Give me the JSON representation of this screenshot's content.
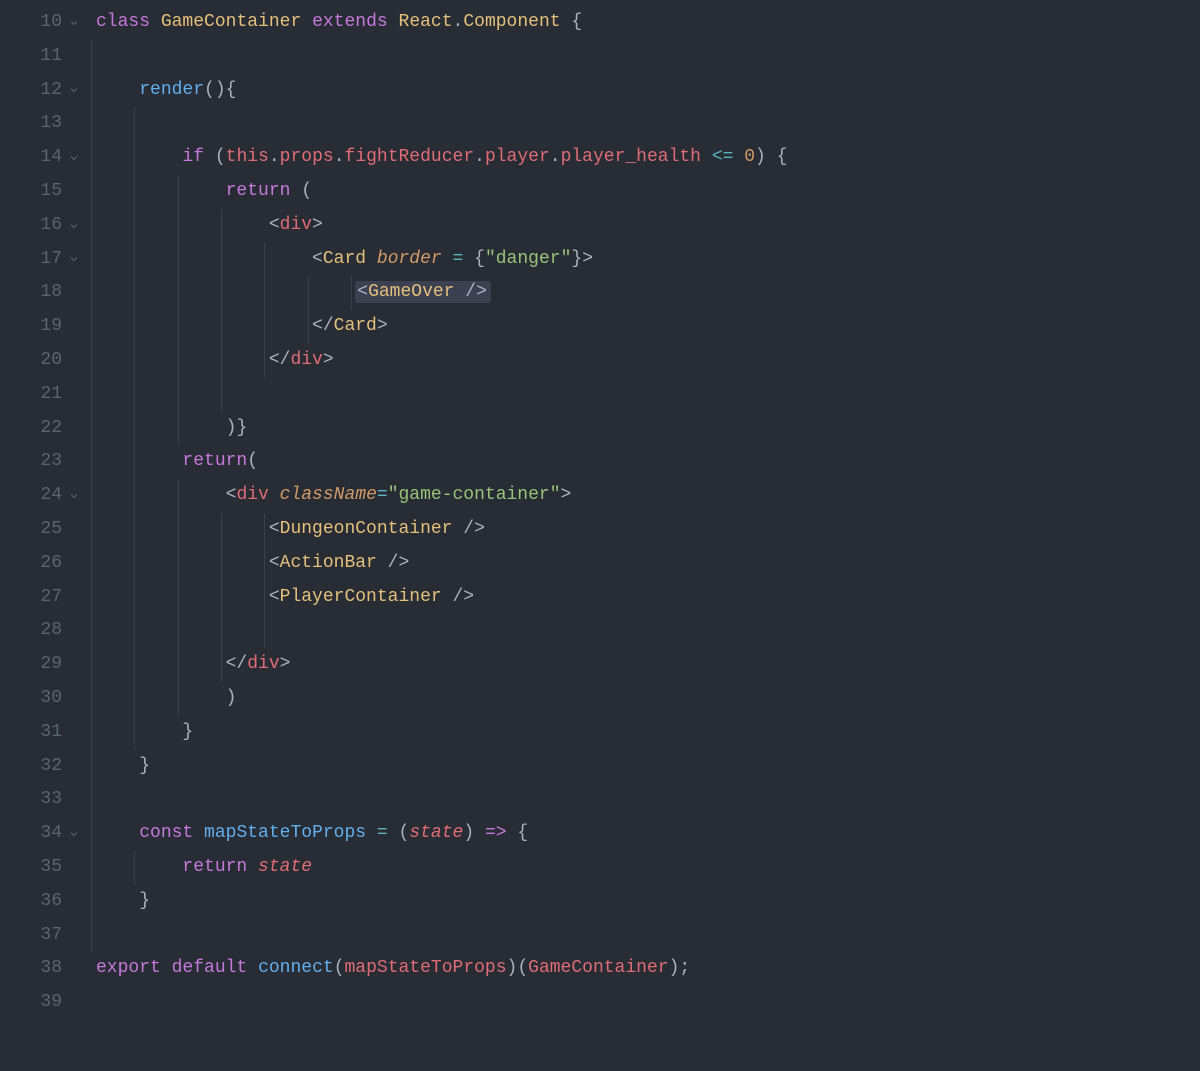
{
  "start_line_number": 10,
  "fold_lines": [
    10,
    12,
    14,
    16,
    17,
    24,
    34
  ],
  "syntax_colors": {
    "keyword": "#c678dd",
    "class": "#e5c07b",
    "function": "#61afef",
    "property": "#e06c75",
    "attribute": "#d19a66",
    "operator": "#56b6c2",
    "string": "#98c379",
    "number": "#d19a66",
    "default": "#abb2bf",
    "background": "#282c34",
    "highlight_bg": "#3b4151"
  },
  "highlighted_line": 18,
  "highlighted_range": "<GameOver />",
  "code_lines": [
    {
      "n": 10,
      "text": "class GameContainer extends React.Component {",
      "tokens": [
        [
          "kw",
          "class"
        ],
        [
          "punc",
          " "
        ],
        [
          "cls",
          "GameContainer"
        ],
        [
          "punc",
          " "
        ],
        [
          "kw",
          "extends"
        ],
        [
          "punc",
          " "
        ],
        [
          "cls",
          "React"
        ],
        [
          "punc",
          "."
        ],
        [
          "cls",
          "Component"
        ],
        [
          "punc",
          " "
        ],
        [
          "punc",
          "{"
        ]
      ]
    },
    {
      "n": 11,
      "text": "",
      "tokens": []
    },
    {
      "n": 12,
      "text": "    render(){",
      "tokens": [
        [
          "punc",
          "    "
        ],
        [
          "fn",
          "render"
        ],
        [
          "punc",
          "()"
        ],
        [
          "punc",
          "{"
        ]
      ]
    },
    {
      "n": 13,
      "text": "",
      "tokens": []
    },
    {
      "n": 14,
      "text": "        if (this.props.fightReducer.player.player_health <= 0) {",
      "tokens": [
        [
          "punc",
          "        "
        ],
        [
          "kw",
          "if"
        ],
        [
          "punc",
          " ("
        ],
        [
          "prop",
          "this"
        ],
        [
          "punc",
          "."
        ],
        [
          "prop",
          "props"
        ],
        [
          "punc",
          "."
        ],
        [
          "prop",
          "fightReducer"
        ],
        [
          "punc",
          "."
        ],
        [
          "prop",
          "player"
        ],
        [
          "punc",
          "."
        ],
        [
          "prop",
          "player_health"
        ],
        [
          "punc",
          " "
        ],
        [
          "op",
          "<="
        ],
        [
          "punc",
          " "
        ],
        [
          "num",
          "0"
        ],
        [
          "punc",
          ") "
        ],
        [
          "punc",
          "{"
        ]
      ]
    },
    {
      "n": 15,
      "text": "            return (",
      "tokens": [
        [
          "punc",
          "            "
        ],
        [
          "kw",
          "return"
        ],
        [
          "punc",
          " ("
        ]
      ]
    },
    {
      "n": 16,
      "text": "                <div>",
      "tokens": [
        [
          "punc",
          "                "
        ],
        [
          "ang",
          "<"
        ],
        [
          "prop",
          "div"
        ],
        [
          "ang",
          ">"
        ]
      ]
    },
    {
      "n": 17,
      "text": "                    <Card border = {\"danger\"}>",
      "tokens": [
        [
          "punc",
          "                    "
        ],
        [
          "ang",
          "<"
        ],
        [
          "cls",
          "Card"
        ],
        [
          "punc",
          " "
        ],
        [
          "attr",
          "border"
        ],
        [
          "punc",
          " "
        ],
        [
          "op",
          "="
        ],
        [
          "punc",
          " "
        ],
        [
          "punc",
          "{"
        ],
        [
          "str",
          "\"danger\""
        ],
        [
          "punc",
          "}"
        ],
        [
          "ang",
          ">"
        ]
      ]
    },
    {
      "n": 18,
      "text": "                        <GameOver />",
      "tokens": [
        [
          "punc",
          "                        "
        ],
        [
          "hl",
          [
            [
              "ang",
              "<"
            ],
            [
              "cls",
              "GameOver"
            ],
            [
              "punc",
              " "
            ],
            [
              "ang",
              "/>"
            ]
          ]
        ]
      ]
    },
    {
      "n": 19,
      "text": "                    </Card>",
      "tokens": [
        [
          "punc",
          "                    "
        ],
        [
          "ang",
          "</"
        ],
        [
          "cls",
          "Card"
        ],
        [
          "ang",
          ">"
        ]
      ]
    },
    {
      "n": 20,
      "text": "                </div>",
      "tokens": [
        [
          "punc",
          "                "
        ],
        [
          "ang",
          "</"
        ],
        [
          "prop",
          "div"
        ],
        [
          "ang",
          ">"
        ]
      ]
    },
    {
      "n": 21,
      "text": "",
      "tokens": []
    },
    {
      "n": 22,
      "text": "            )}",
      "tokens": [
        [
          "punc",
          "            )"
        ],
        [
          "punc",
          "}"
        ]
      ]
    },
    {
      "n": 23,
      "text": "        return(",
      "tokens": [
        [
          "punc",
          "        "
        ],
        [
          "kw",
          "return"
        ],
        [
          "punc",
          "("
        ]
      ]
    },
    {
      "n": 24,
      "text": "            <div className=\"game-container\">",
      "tokens": [
        [
          "punc",
          "            "
        ],
        [
          "ang",
          "<"
        ],
        [
          "prop",
          "div"
        ],
        [
          "punc",
          " "
        ],
        [
          "attr",
          "className"
        ],
        [
          "op",
          "="
        ],
        [
          "str",
          "\"game-container\""
        ],
        [
          "ang",
          ">"
        ]
      ]
    },
    {
      "n": 25,
      "text": "                <DungeonContainer />",
      "tokens": [
        [
          "punc",
          "                "
        ],
        [
          "ang",
          "<"
        ],
        [
          "cls",
          "DungeonContainer"
        ],
        [
          "punc",
          " "
        ],
        [
          "ang",
          "/>"
        ]
      ]
    },
    {
      "n": 26,
      "text": "                <ActionBar />",
      "tokens": [
        [
          "punc",
          "                "
        ],
        [
          "ang",
          "<"
        ],
        [
          "cls",
          "ActionBar"
        ],
        [
          "punc",
          " "
        ],
        [
          "ang",
          "/>"
        ]
      ]
    },
    {
      "n": 27,
      "text": "                <PlayerContainer />",
      "tokens": [
        [
          "punc",
          "                "
        ],
        [
          "ang",
          "<"
        ],
        [
          "cls",
          "PlayerContainer"
        ],
        [
          "punc",
          " "
        ],
        [
          "ang",
          "/>"
        ]
      ]
    },
    {
      "n": 28,
      "text": "",
      "tokens": []
    },
    {
      "n": 29,
      "text": "            </div>",
      "tokens": [
        [
          "punc",
          "            "
        ],
        [
          "ang",
          "</"
        ],
        [
          "prop",
          "div"
        ],
        [
          "ang",
          ">"
        ]
      ]
    },
    {
      "n": 30,
      "text": "            )",
      "tokens": [
        [
          "punc",
          "            )"
        ]
      ]
    },
    {
      "n": 31,
      "text": "        }",
      "tokens": [
        [
          "punc",
          "        "
        ],
        [
          "punc",
          "}"
        ]
      ]
    },
    {
      "n": 32,
      "text": "    }",
      "tokens": [
        [
          "punc",
          "    "
        ],
        [
          "punc",
          "}"
        ]
      ]
    },
    {
      "n": 33,
      "text": "",
      "tokens": []
    },
    {
      "n": 34,
      "text": "    const mapStateToProps = (state) => {",
      "tokens": [
        [
          "punc",
          "    "
        ],
        [
          "kw",
          "const"
        ],
        [
          "punc",
          " "
        ],
        [
          "fn",
          "mapStateToProps"
        ],
        [
          "punc",
          " "
        ],
        [
          "op",
          "="
        ],
        [
          "punc",
          " ("
        ],
        [
          "param",
          "state"
        ],
        [
          "punc",
          ") "
        ],
        [
          "kw",
          "=>"
        ],
        [
          "punc",
          " "
        ],
        [
          "punc",
          "{"
        ]
      ]
    },
    {
      "n": 35,
      "text": "        return state",
      "tokens": [
        [
          "punc",
          "        "
        ],
        [
          "kw",
          "return"
        ],
        [
          "punc",
          " "
        ],
        [
          "param",
          "state"
        ]
      ]
    },
    {
      "n": 36,
      "text": "    }",
      "tokens": [
        [
          "punc",
          "    "
        ],
        [
          "punc",
          "}"
        ]
      ]
    },
    {
      "n": 37,
      "text": "",
      "tokens": []
    },
    {
      "n": 38,
      "text": "export default connect(mapStateToProps)(GameContainer);",
      "tokens": [
        [
          "kw",
          "export"
        ],
        [
          "punc",
          " "
        ],
        [
          "kw",
          "default"
        ],
        [
          "punc",
          " "
        ],
        [
          "fn",
          "connect"
        ],
        [
          "punc",
          "("
        ],
        [
          "prop",
          "mapStateToProps"
        ],
        [
          "punc",
          ")("
        ],
        [
          "prop",
          "GameContainer"
        ],
        [
          "punc",
          ");"
        ]
      ]
    },
    {
      "n": 39,
      "text": "",
      "tokens": []
    }
  ],
  "indent_guides": [
    {
      "col": 0,
      "from": 11,
      "to": 37
    },
    {
      "col": 4,
      "from": 13,
      "to": 31
    },
    {
      "col": 8,
      "from": 15,
      "to": 22
    },
    {
      "col": 12,
      "from": 16,
      "to": 21
    },
    {
      "col": 16,
      "from": 17,
      "to": 20
    },
    {
      "col": 20,
      "from": 18,
      "to": 19
    },
    {
      "col": 24,
      "from": 18,
      "to": 18
    },
    {
      "col": 8,
      "from": 24,
      "to": 30
    },
    {
      "col": 12,
      "from": 25,
      "to": 29
    },
    {
      "col": 16,
      "from": 25,
      "to": 28
    },
    {
      "col": 4,
      "from": 35,
      "to": 35
    }
  ]
}
